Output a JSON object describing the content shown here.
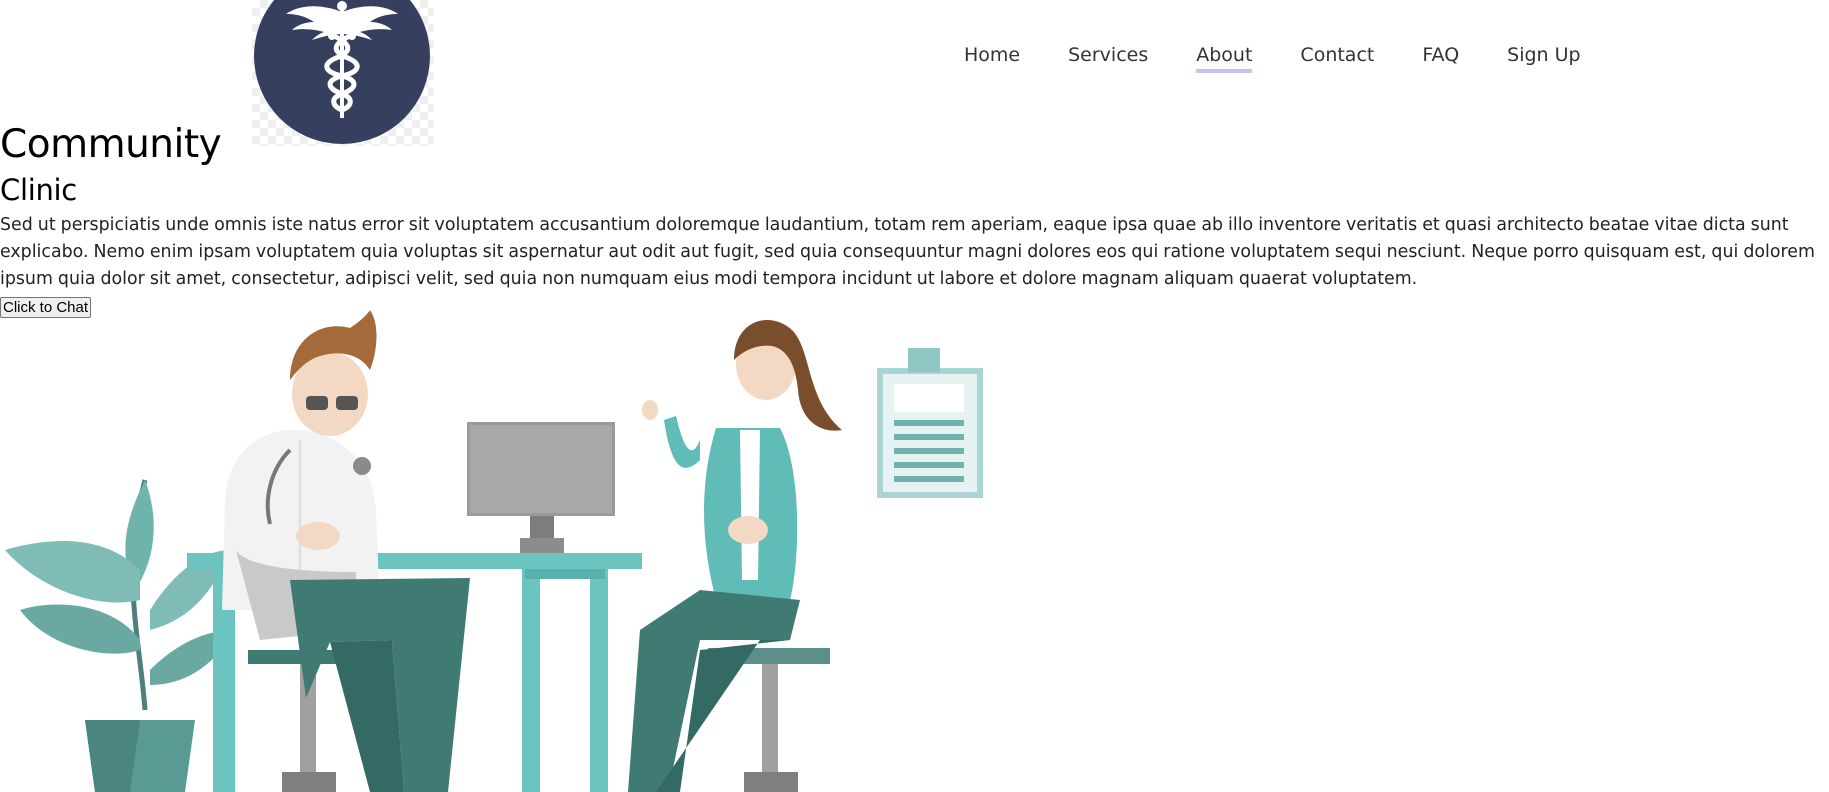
{
  "logo": {
    "icon": "caduceus-icon",
    "bg_color": "#363f5e"
  },
  "nav": {
    "items": [
      {
        "label": "Home"
      },
      {
        "label": "Services"
      },
      {
        "label": "About"
      },
      {
        "label": "Contact"
      },
      {
        "label": "FAQ"
      },
      {
        "label": "Sign Up"
      }
    ],
    "active": "About",
    "active_underline_color": "#c3c1ee"
  },
  "hero": {
    "title": "Community",
    "subtitle": "Clinic",
    "description": "Sed ut perspiciatis unde omnis iste natus error sit voluptatem accusantium doloremque laudantium, totam rem aperiam, eaque ipsa quae ab illo inventore veritatis et quasi architecto beatae vitae dicta sunt explicabo. Nemo enim ipsam voluptatem quia voluptas sit aspernatur aut odit aut fugit, sed quia consequuntur magni dolores eos qui ratione voluptatem sequi nesciunt. Neque porro quisquam est, qui dolorem ipsum quia dolor sit amet, consectetur, adipisci velit, sed quia non numquam eius modi tempora incidunt ut labore et dolore magnam aliquam quaerat voluptatem.",
    "chat_button": "Click to Chat"
  },
  "illustration": {
    "name": "doctor-patient-consultation-illustration",
    "colors": {
      "teal": "#6cc4c0",
      "dark_teal": "#3f7a73",
      "grey": "#9a9a9a"
    }
  }
}
